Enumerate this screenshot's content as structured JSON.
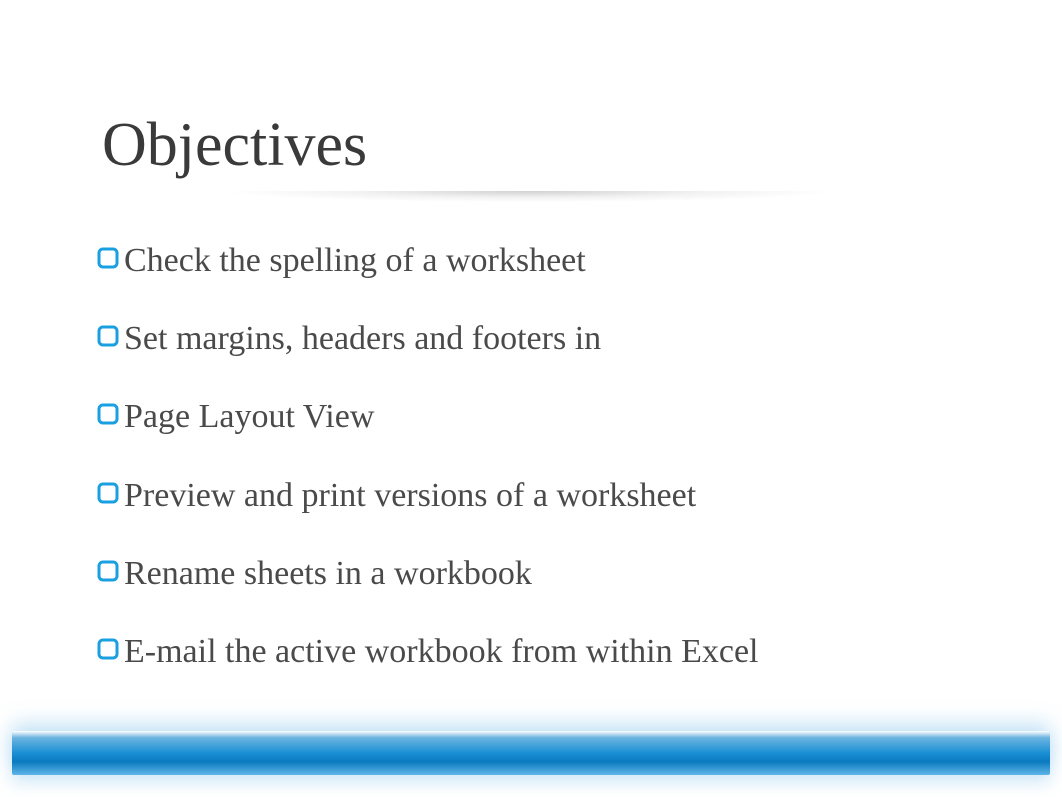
{
  "slide": {
    "title": "Objectives",
    "bullets": [
      "Check the spelling of a worksheet",
      "Set margins, headers and footers in",
      "Page Layout View",
      "Preview and print versions of a worksheet",
      "Rename sheets in a workbook",
      "E-mail the active workbook from within Excel"
    ],
    "colors": {
      "bullet_icon": "#1a9fe0",
      "accent_bar": "#1a8fd4"
    }
  }
}
